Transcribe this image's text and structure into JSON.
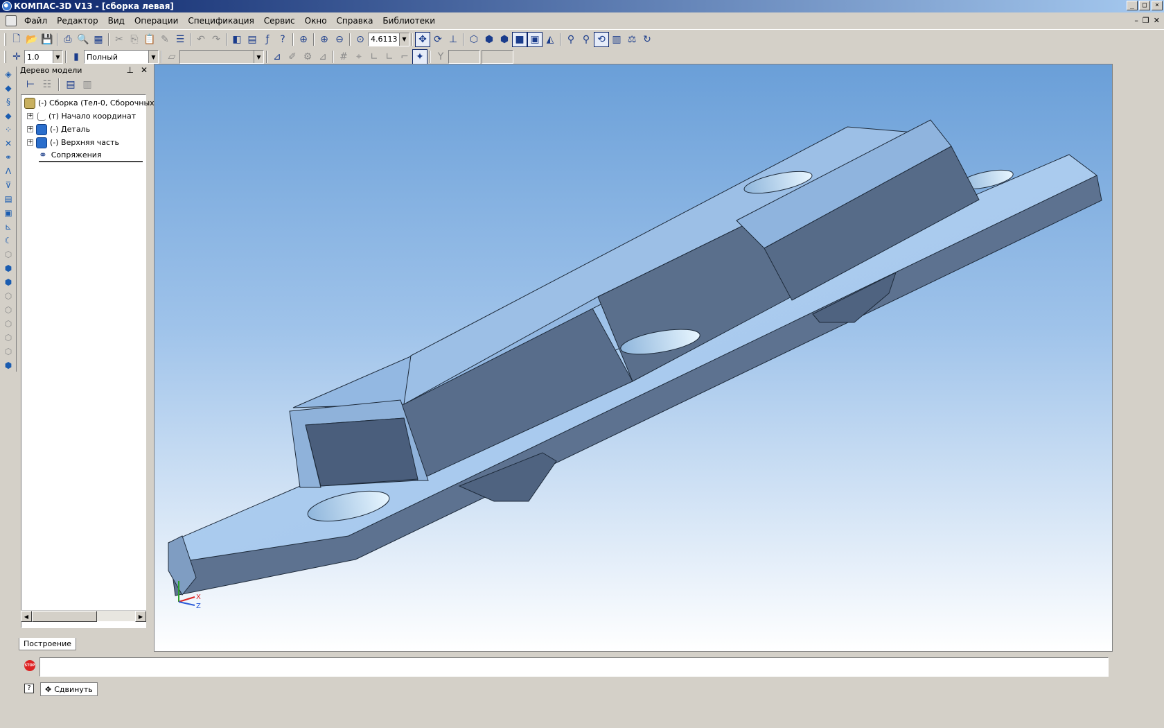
{
  "window": {
    "title": "КОМПАС-3D V13 - [сборка левая]",
    "buttons": [
      "_",
      "□",
      "×"
    ]
  },
  "menu": [
    "Файл",
    "Редактор",
    "Вид",
    "Операции",
    "Спецификация",
    "Сервис",
    "Окно",
    "Справка",
    "Библиотеки"
  ],
  "toolbar": {
    "zoom_value": "4.6113",
    "step_value": "1.0",
    "display_mode": "Полный"
  },
  "tree": {
    "title": "Дерево модели",
    "items": [
      {
        "label": "(-) Сборка (Тел-0, Сборочных е",
        "icon": "assembly-icon"
      },
      {
        "label": "(т) Начало координат",
        "icon": "coordinate-origin-icon"
      },
      {
        "label": "(-) Деталь",
        "icon": "part-icon"
      },
      {
        "label": "(-) Верхняя часть",
        "icon": "part-icon"
      },
      {
        "label": "Сопряжения",
        "icon": "mates-icon"
      }
    ],
    "tab_label": "Построение"
  },
  "axis": {
    "x": "X",
    "z": "Z"
  },
  "status": {
    "stop_label": "STOP",
    "shift_label": "Сдвинуть"
  },
  "colors": {
    "title_bar": "#0a246a",
    "viewport_top": "#6a9fd8",
    "model_light": "#a8c8ec",
    "model_dark": "#5a6f8c"
  }
}
